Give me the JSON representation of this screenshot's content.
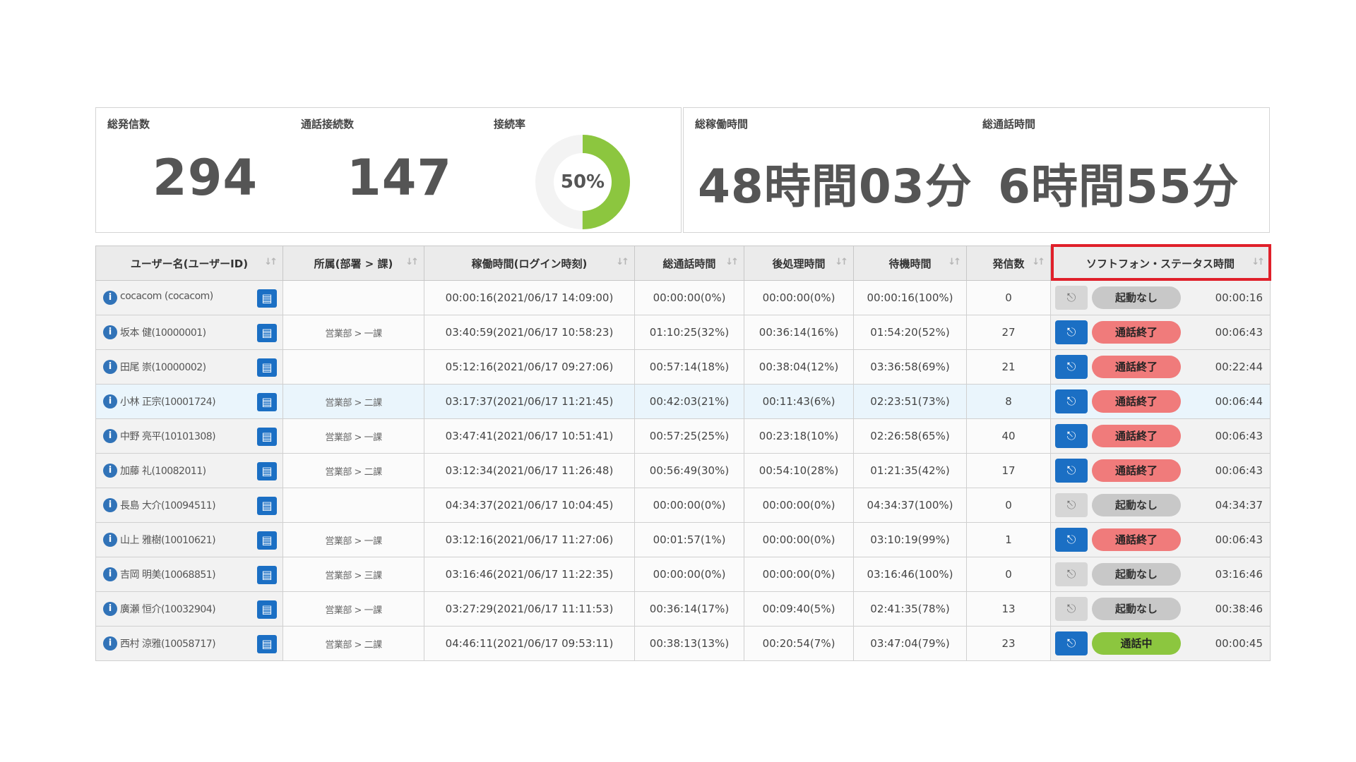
{
  "summary": {
    "total_calls_label": "総発信数",
    "total_calls_value": "294",
    "connected_label": "通話接続数",
    "connected_value": "147",
    "rate_label": "接続率",
    "rate_value": "50%",
    "rate_fraction": 0.5,
    "work_time_label": "総稼働時間",
    "work_time_value": "48時間03分",
    "talk_time_label": "総通話時間",
    "talk_time_value": "6時間55分"
  },
  "colors": {
    "donut_fill": "#8cc63f",
    "donut_track": "#f3f3f3",
    "highlight_border": "#e0202a",
    "button_blue": "#1b6fc4",
    "status_end": "#f07b7b",
    "status_active": "#8cc63f"
  },
  "table": {
    "headers": [
      "ユーザー名(ユーザーID)",
      "所属(部署 > 課)",
      "稼働時間(ログイン時刻)",
      "総通話時間",
      "後処理時間",
      "待機時間",
      "発信数",
      "ソフトフォン・ステータス時間"
    ],
    "sort_icon": "sort-arrows-icon",
    "rows": [
      {
        "user": "cocacom (cocacom)",
        "dept": "",
        "work": "00:00:16(2021/06/17 14:09:00)",
        "talk": "00:00:00(0%)",
        "post": "00:00:00(0%)",
        "wait": "00:00:16(100%)",
        "calls": "0",
        "headset": "off",
        "status": "起動なし",
        "status_type": "none",
        "status_time": "00:00:16"
      },
      {
        "user": "坂本 健(10000001)",
        "dept": "営業部 > 一課",
        "work": "03:40:59(2021/06/17 10:58:23)",
        "talk": "01:10:25(32%)",
        "post": "00:36:14(16%)",
        "wait": "01:54:20(52%)",
        "calls": "27",
        "headset": "on",
        "status": "通話終了",
        "status_type": "end",
        "status_time": "00:06:43"
      },
      {
        "user": "田尾 崇(10000002)",
        "dept": "",
        "work": "05:12:16(2021/06/17 09:27:06)",
        "talk": "00:57:14(18%)",
        "post": "00:38:04(12%)",
        "wait": "03:36:58(69%)",
        "calls": "21",
        "headset": "on",
        "status": "通話終了",
        "status_type": "end",
        "status_time": "00:22:44"
      },
      {
        "user": "小林 正宗(10001724)",
        "dept": "営業部 > 二課",
        "work": "03:17:37(2021/06/17 11:21:45)",
        "talk": "00:42:03(21%)",
        "post": "00:11:43(6%)",
        "wait": "02:23:51(73%)",
        "calls": "8",
        "headset": "on",
        "status": "通話終了",
        "status_type": "end",
        "status_time": "00:06:44"
      },
      {
        "user": "中野 亮平(10101308)",
        "dept": "営業部 > 一課",
        "work": "03:47:41(2021/06/17 10:51:41)",
        "talk": "00:57:25(25%)",
        "post": "00:23:18(10%)",
        "wait": "02:26:58(65%)",
        "calls": "40",
        "headset": "on",
        "status": "通話終了",
        "status_type": "end",
        "status_time": "00:06:43"
      },
      {
        "user": "加藤 礼(10082011)",
        "dept": "営業部 > 二課",
        "work": "03:12:34(2021/06/17 11:26:48)",
        "talk": "00:56:49(30%)",
        "post": "00:54:10(28%)",
        "wait": "01:21:35(42%)",
        "calls": "17",
        "headset": "on",
        "status": "通話終了",
        "status_type": "end",
        "status_time": "00:06:43"
      },
      {
        "user": "長島 大介(10094511)",
        "dept": "",
        "work": "04:34:37(2021/06/17 10:04:45)",
        "talk": "00:00:00(0%)",
        "post": "00:00:00(0%)",
        "wait": "04:34:37(100%)",
        "calls": "0",
        "headset": "off",
        "status": "起動なし",
        "status_type": "none",
        "status_time": "04:34:37"
      },
      {
        "user": "山上 雅樹(10010621)",
        "dept": "営業部 > 一課",
        "work": "03:12:16(2021/06/17 11:27:06)",
        "talk": "00:01:57(1%)",
        "post": "00:00:00(0%)",
        "wait": "03:10:19(99%)",
        "calls": "1",
        "headset": "on",
        "status": "通話終了",
        "status_type": "end",
        "status_time": "00:06:43"
      },
      {
        "user": "吉岡 明美(10068851)",
        "dept": "営業部 > 三課",
        "work": "03:16:46(2021/06/17 11:22:35)",
        "talk": "00:00:00(0%)",
        "post": "00:00:00(0%)",
        "wait": "03:16:46(100%)",
        "calls": "0",
        "headset": "off",
        "status": "起動なし",
        "status_type": "none",
        "status_time": "03:16:46"
      },
      {
        "user": "廣瀬 恒介(10032904)",
        "dept": "営業部 > 一課",
        "work": "03:27:29(2021/06/17 11:11:53)",
        "talk": "00:36:14(17%)",
        "post": "00:09:40(5%)",
        "wait": "02:41:35(78%)",
        "calls": "13",
        "headset": "off",
        "status": "起動なし",
        "status_type": "none",
        "status_time": "00:38:46"
      },
      {
        "user": "西村 涼雅(10058717)",
        "dept": "営業部 > 二課",
        "work": "04:46:11(2021/06/17 09:53:11)",
        "talk": "00:38:13(13%)",
        "post": "00:20:54(7%)",
        "wait": "03:47:04(79%)",
        "calls": "23",
        "headset": "on",
        "status": "通話中",
        "status_type": "active",
        "status_time": "00:00:45"
      }
    ]
  }
}
